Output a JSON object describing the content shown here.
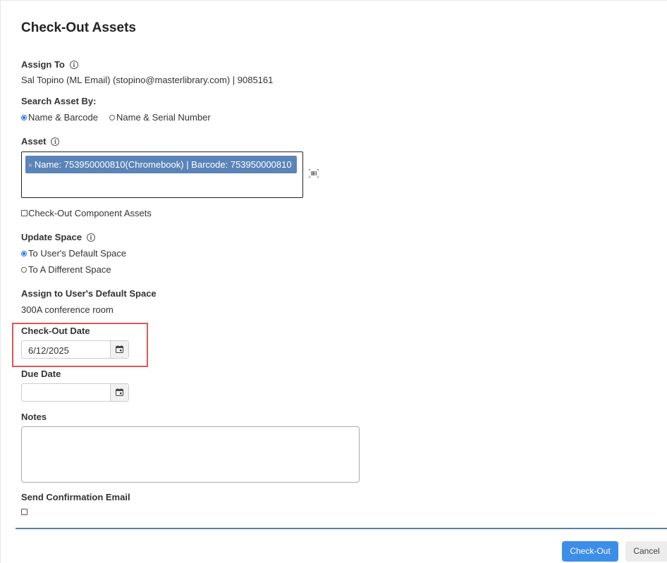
{
  "dialog": {
    "title": "Check-Out Assets"
  },
  "assign_to": {
    "label": "Assign To",
    "value": "Sal Topino (ML Email) (stopino@masterlibrary.com) | 9085161"
  },
  "search_by": {
    "label": "Search Asset By:",
    "options": [
      {
        "label": "Name & Barcode",
        "checked": true
      },
      {
        "label": "Name & Serial Number",
        "checked": false
      }
    ]
  },
  "asset": {
    "label": "Asset",
    "selected_tag": "Name: 753950000810(Chromebook) | Barcode: 753950000810",
    "tag_remove": "×"
  },
  "component_assets": {
    "label": "Check-Out Component Assets",
    "checked": false
  },
  "update_space": {
    "label": "Update Space",
    "options": [
      {
        "label": "To User's Default Space",
        "checked": true
      },
      {
        "label": "To A Different Space",
        "checked": false
      }
    ]
  },
  "default_space": {
    "label": "Assign to User's Default Space",
    "value": "300A conference room"
  },
  "checkout_date": {
    "label": "Check-Out Date",
    "value": "6/12/2025"
  },
  "due_date": {
    "label": "Due Date",
    "value": ""
  },
  "notes": {
    "label": "Notes",
    "value": ""
  },
  "confirmation_email": {
    "label": "Send Confirmation Email",
    "checked": false
  },
  "footer": {
    "checkout_button": "Check-Out",
    "cancel_button": "Cancel"
  },
  "colors": {
    "accent": "#3d8ee8",
    "tag_bg": "#5b84b8",
    "highlight": "#e05555",
    "divider": "#5580a8"
  }
}
